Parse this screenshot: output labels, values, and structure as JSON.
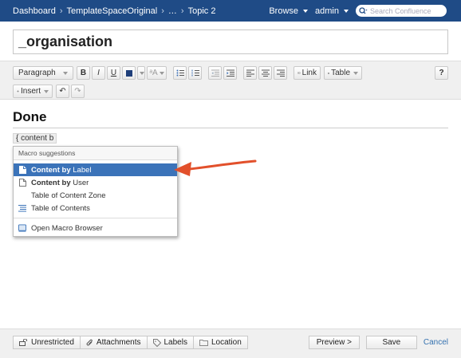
{
  "topbar": {
    "breadcrumbs": [
      "Dashboard",
      "TemplateSpaceOriginal",
      "…",
      "Topic 2"
    ],
    "browse_label": "Browse",
    "user_label": "admin",
    "search_placeholder": "Search Confluence"
  },
  "page": {
    "title": "_organisation"
  },
  "toolbar": {
    "paragraph_label": "Paragraph",
    "bold": "B",
    "italic": "I",
    "underline": "U",
    "text_color_value": "#1f3f7a",
    "styles_label": "ᵃA",
    "link_label": "Link",
    "table_label": "Table",
    "help_label": "?",
    "insert_label": "Insert"
  },
  "content": {
    "heading": "Done",
    "typed_text": "{ content b"
  },
  "macro_suggestions": {
    "header": "Macro suggestions",
    "items": [
      {
        "bold": "Content by",
        "rest": " Label",
        "icon": "page-icon",
        "active": true
      },
      {
        "bold": "Content by",
        "rest": " User",
        "icon": "page-outline-icon",
        "active": false
      },
      {
        "bold": "",
        "rest": "Table of Content Zone",
        "icon": "",
        "active": false
      },
      {
        "bold": "",
        "rest": "Table of Contents",
        "icon": "toc-icon",
        "active": false
      }
    ],
    "browser_label": "Open Macro Browser"
  },
  "footer": {
    "restrictions_label": "Unrestricted",
    "attachments_label": "Attachments",
    "labels_label": "Labels",
    "location_label": "Location",
    "preview_label": "Preview >",
    "save_label": "Save",
    "cancel_label": "Cancel"
  },
  "colors": {
    "topbar": "#1f4b86",
    "active_item": "#3b73b9",
    "arrow": "#e2502b",
    "link": "#3572b0"
  }
}
